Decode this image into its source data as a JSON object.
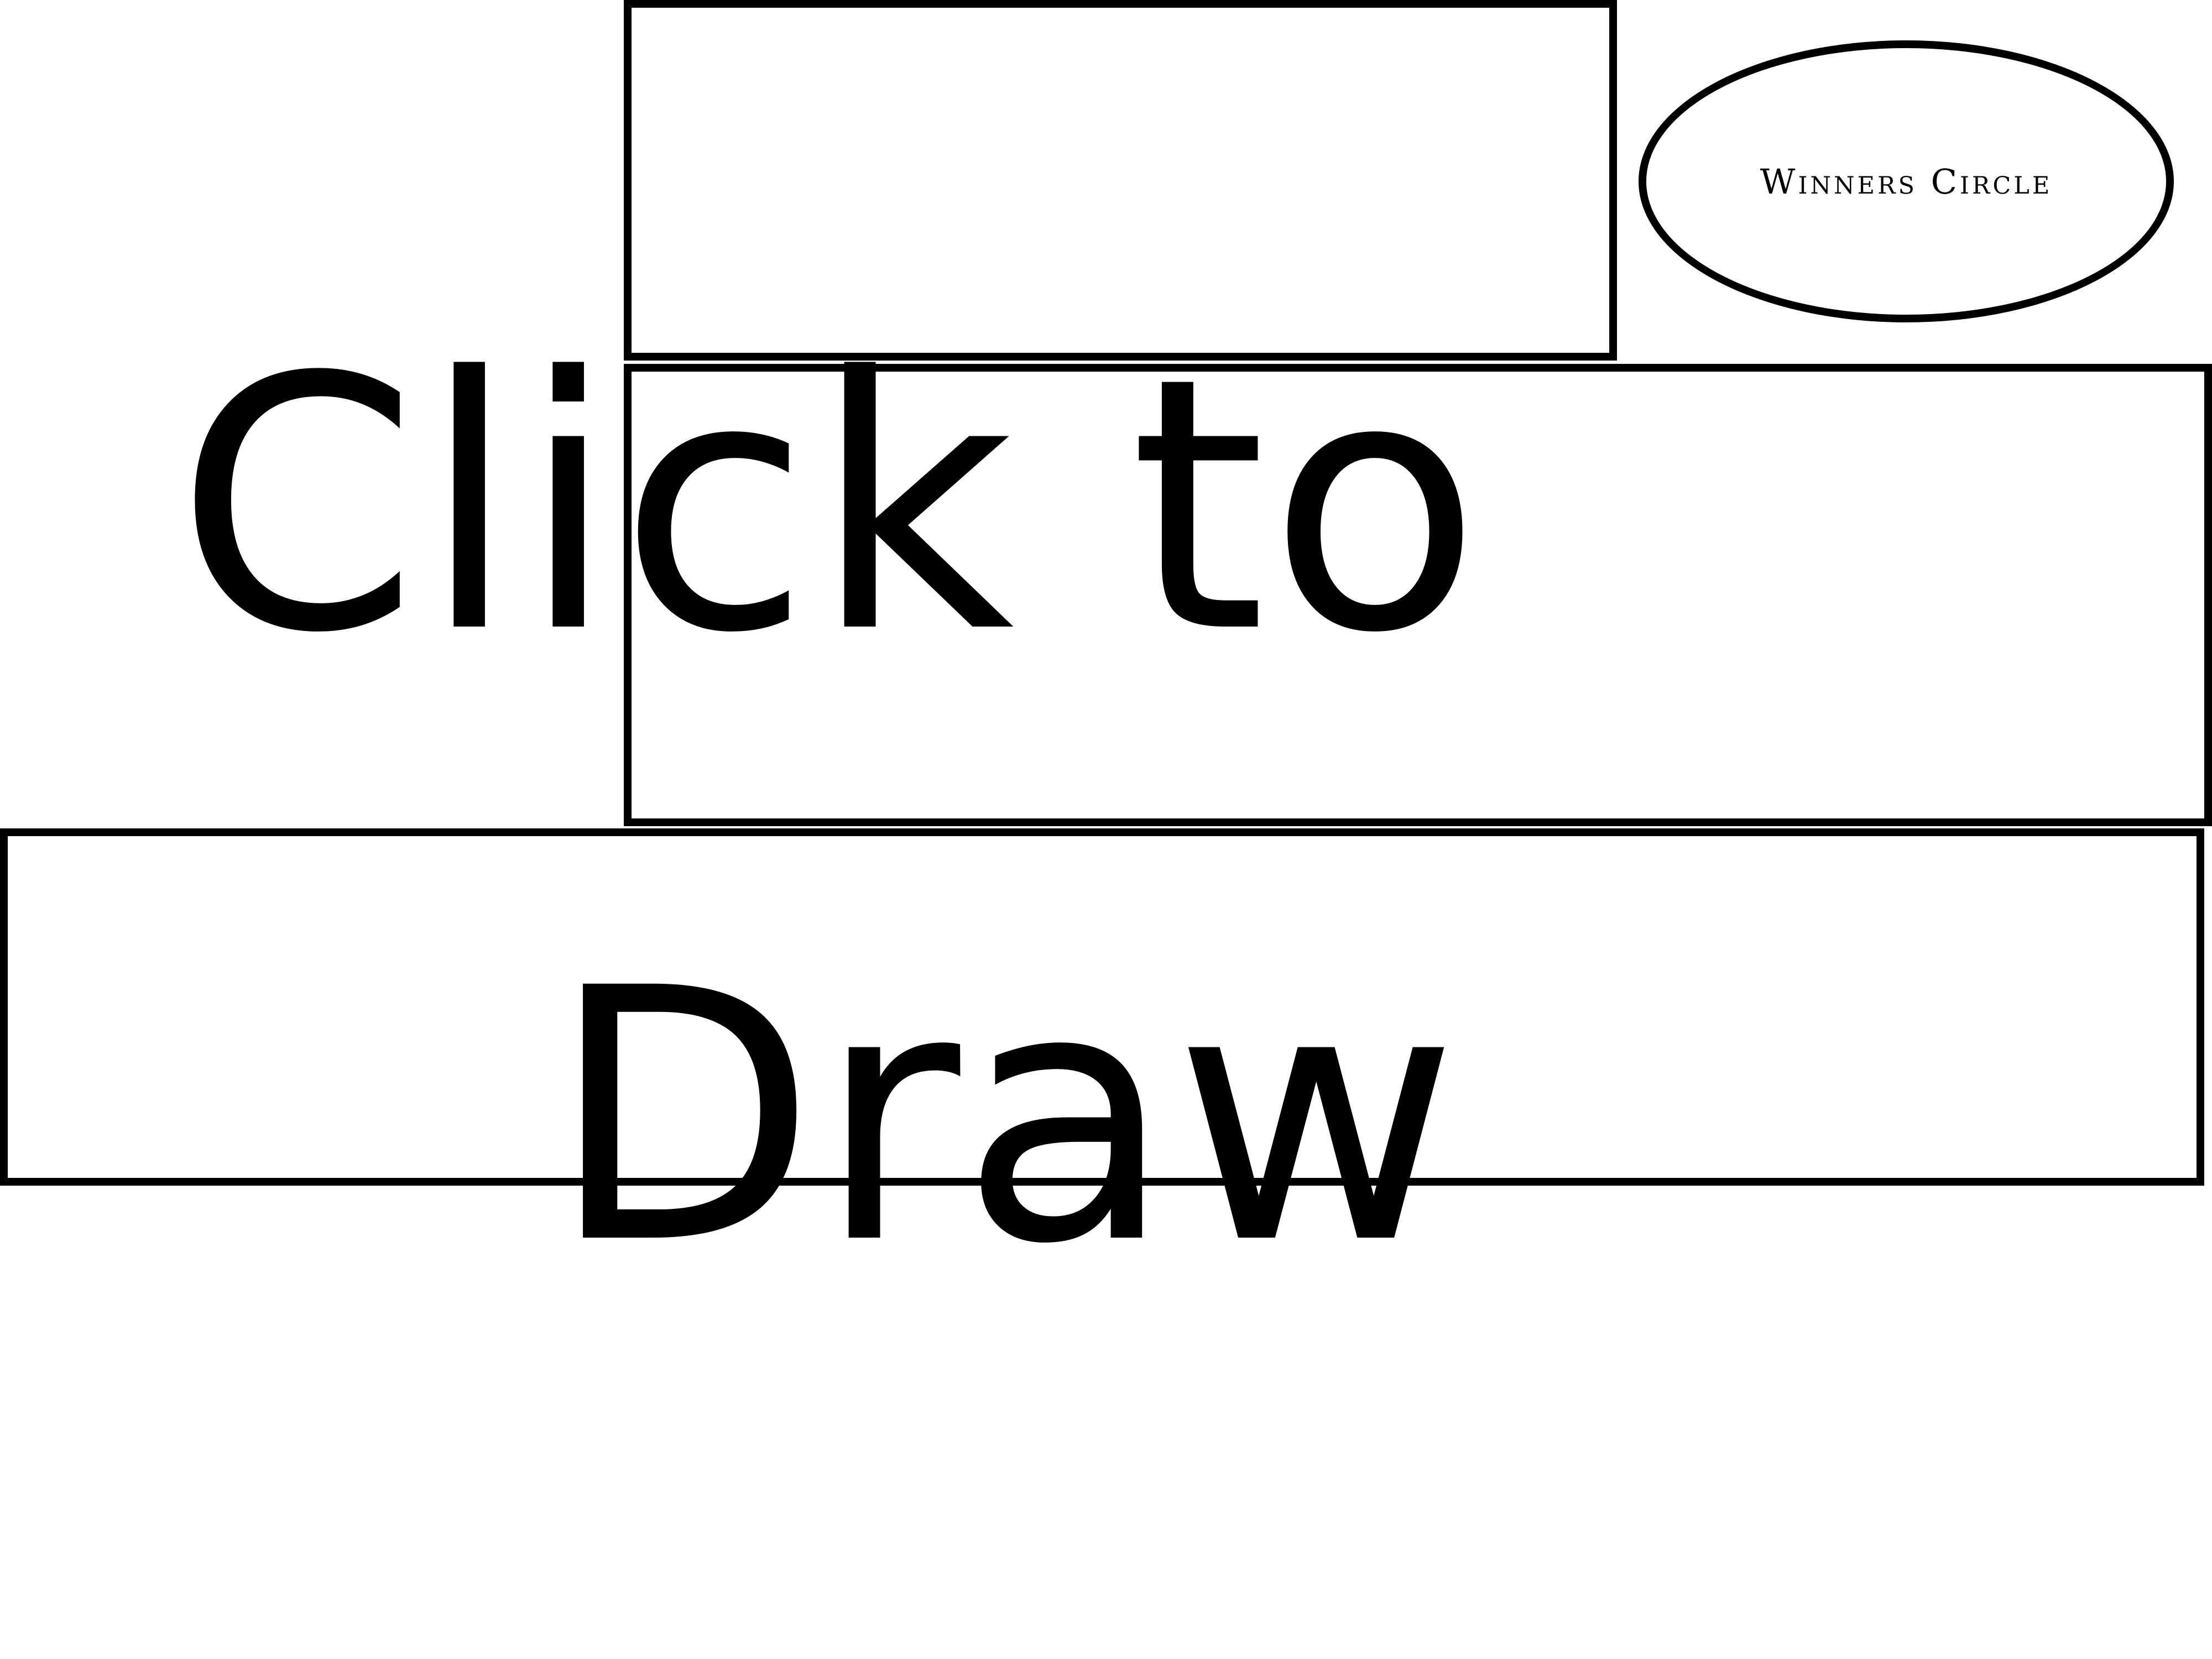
{
  "winners_circle": {
    "label": "Winners Circle"
  },
  "prompt": {
    "line1": "Click to",
    "line2": "Draw"
  },
  "colors": {
    "background": "#ffffff",
    "ink": "#000000"
  }
}
